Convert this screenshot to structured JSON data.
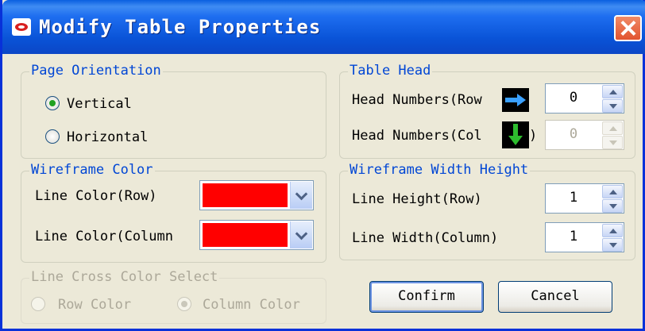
{
  "window": {
    "title": "Modify Table Properties",
    "icon": "app-icon",
    "close_icon": "close-icon"
  },
  "page_orientation": {
    "legend": "Page Orientation",
    "options": [
      {
        "label": "Vertical",
        "checked": true
      },
      {
        "label": "Horizontal",
        "checked": false
      }
    ]
  },
  "wireframe_color": {
    "legend": "Wireframe Color",
    "row_label": "Line Color(Row)",
    "row_color": "#ff0000",
    "column_label": "Line Color(Column",
    "column_color": "#ff0000"
  },
  "line_cross": {
    "legend": "Line Cross Color Select",
    "disabled": true,
    "options": [
      {
        "label": "Row Color",
        "checked": false
      },
      {
        "label": "Column Color",
        "checked": true
      }
    ]
  },
  "table_head": {
    "legend": "Table Head",
    "row_label": "Head Numbers(Row",
    "row_icon": "arrow-right-icon",
    "row_value": "0",
    "column_label": "Head Numbers(Col",
    "column_label_tail": ")",
    "column_icon": "arrow-down-icon",
    "column_value": "0",
    "column_disabled": true
  },
  "wireframe_size": {
    "legend": "Wireframe Width Height",
    "height_label": "Line Height(Row)",
    "height_value": "1",
    "width_label": "Line Width(Column)",
    "width_value": "1"
  },
  "buttons": {
    "confirm": "Confirm",
    "cancel": "Cancel"
  },
  "colors": {
    "title_bar": "#0a54d8",
    "legend_text": "#0046d5",
    "dialog_bg": "#ece9d8",
    "disabled_text": "#aca899"
  }
}
